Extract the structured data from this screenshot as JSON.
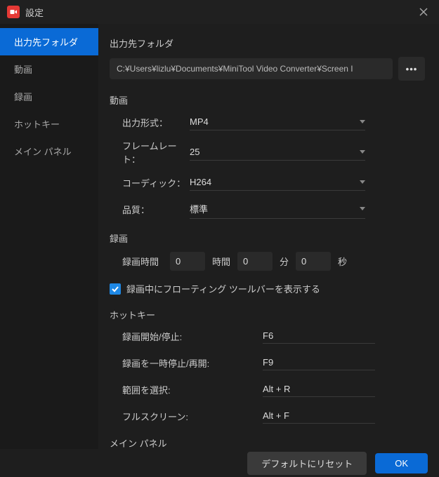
{
  "titlebar": {
    "title": "設定"
  },
  "sidebar": {
    "items": [
      {
        "label": "出力先フォルダ"
      },
      {
        "label": "動画"
      },
      {
        "label": "録画"
      },
      {
        "label": "ホットキー"
      },
      {
        "label": "メイン パネル"
      }
    ]
  },
  "sections": {
    "output": {
      "title": "出力先フォルダ",
      "path": "C:¥Users¥lizlu¥Documents¥MiniTool Video Converter¥Screen I",
      "browse": "•••"
    },
    "video": {
      "title": "動画",
      "format_label": "出力形式：",
      "format_value": "MP4",
      "framerate_label": "フレームレート：",
      "framerate_value": "25",
      "codec_label": "コーディック：",
      "codec_value": "H264",
      "quality_label": "品質：",
      "quality_value": "標準"
    },
    "record": {
      "title": "録画",
      "time_label": "録画時間",
      "hours": "0",
      "hours_unit": "時間",
      "minutes": "0",
      "minutes_unit": "分",
      "seconds": "0",
      "seconds_unit": "秒",
      "toolbar_check": "録画中にフローティング ツールバーを表示する"
    },
    "hotkey": {
      "title": "ホットキー",
      "start_stop_label": "録画開始/停止:",
      "start_stop_value": "F6",
      "pause_label": "録画を一時停止/再開:",
      "pause_value": "F9",
      "region_label": "範囲を選択:",
      "region_value": "Alt + R",
      "fullscreen_label": "フルスクリーン:",
      "fullscreen_value": "Alt + F"
    },
    "mainpanel": {
      "title": "メイン パネル"
    }
  },
  "footer": {
    "reset": "デフォルトにリセット",
    "ok": "OK"
  }
}
